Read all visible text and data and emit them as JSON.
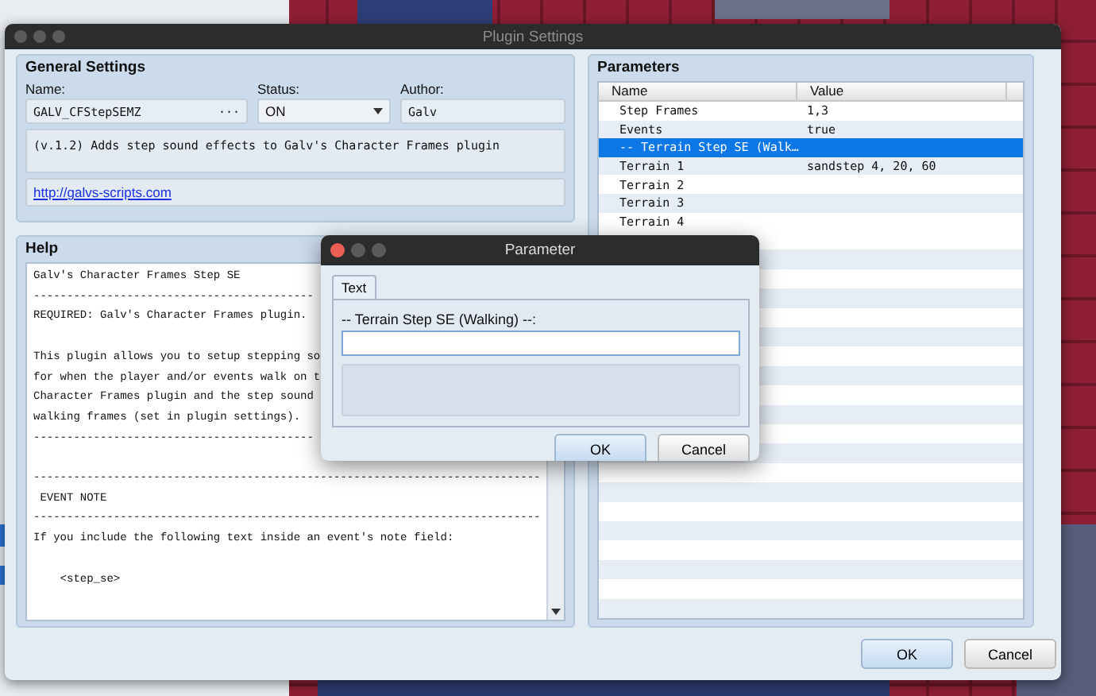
{
  "main_window": {
    "title": "Plugin Settings",
    "general_settings": {
      "heading": "General Settings",
      "name_label": "Name:",
      "name_value": "GALV_CFStepSEMZ",
      "name_button": "···",
      "status_label": "Status:",
      "status_value": "ON",
      "author_label": "Author:",
      "author_value": "Galv",
      "description": "(v.1.2) Adds step sound effects to Galv's Character Frames plugin",
      "url": "http://galvs-scripts.com"
    },
    "help": {
      "heading": "Help",
      "lines": [
        {
          "kind": "text",
          "text": "Galv's Character Frames Step SE"
        },
        {
          "kind": "text",
          "text": "------------------------------------------"
        },
        {
          "kind": "text",
          "text": "REQUIRED: Galv's Character Frames plugin."
        },
        {
          "kind": "blank"
        },
        {
          "kind": "text",
          "text": "This plugin allows you to setup stepping so"
        },
        {
          "kind": "text",
          "text": "for when the player and/or events walk on t"
        },
        {
          "kind": "text",
          "text": "Character Frames plugin and the step sound"
        },
        {
          "kind": "text",
          "text": "walking frames (set in plugin settings)."
        },
        {
          "kind": "text",
          "text": "------------------------------------------"
        },
        {
          "kind": "blank"
        },
        {
          "kind": "text",
          "text": "----------------------------------------------------------------------------"
        },
        {
          "kind": "text",
          "text": " EVENT NOTE"
        },
        {
          "kind": "text",
          "text": "----------------------------------------------------------------------------"
        },
        {
          "kind": "text",
          "text": "If you include the following text inside an event's note field:"
        },
        {
          "kind": "blank"
        },
        {
          "kind": "text",
          "text": "    <step_se>"
        }
      ]
    },
    "parameters": {
      "heading": "Parameters",
      "columns": [
        "Name",
        "Value"
      ],
      "rows": [
        {
          "name": "Step Frames",
          "value": "1,3",
          "selected": false
        },
        {
          "name": "Events",
          "value": "true",
          "selected": false
        },
        {
          "name": "-- Terrain Step SE (Walk…",
          "selected": true
        },
        {
          "name": "Terrain 1",
          "value": "sandstep 4, 20, 60",
          "selected": false
        },
        {
          "name": "Terrain 2",
          "selected": false
        },
        {
          "name": "Terrain 3",
          "selected": false
        },
        {
          "name": "Terrain 4",
          "selected": false
        }
      ]
    },
    "buttons": [
      "OK",
      "Cancel"
    ]
  },
  "dialog": {
    "title": "Parameter",
    "tabs": [
      {
        "label": "Text",
        "selected": true
      }
    ],
    "field_label": "-- Terrain Step SE (Walking) --:",
    "buttons": [
      "OK",
      "Cancel"
    ]
  }
}
